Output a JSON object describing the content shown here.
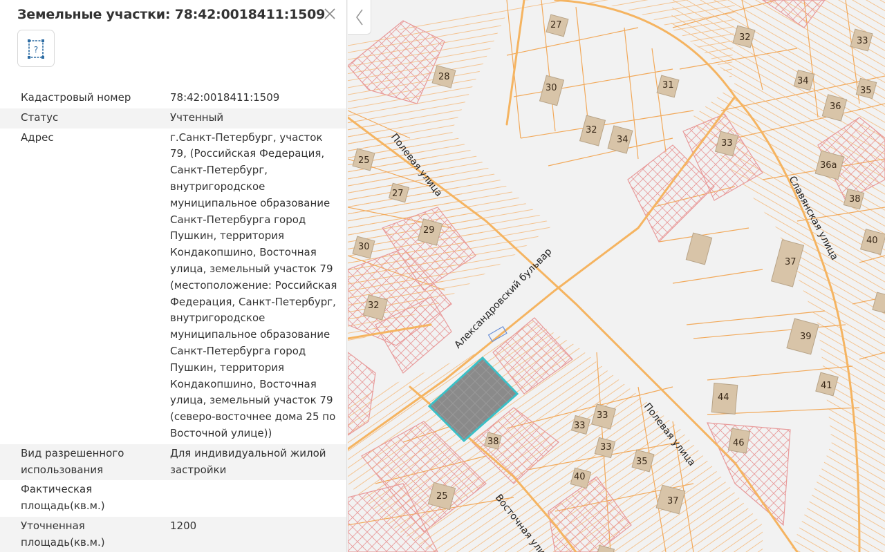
{
  "panel": {
    "title": "Земельные участки: 78:42:0018411:1509",
    "info_button_glyph": "?",
    "rows": [
      {
        "label": "Кадастровый номер",
        "value": "78:42:0018411:1509"
      },
      {
        "label": "Статус",
        "value": "Учтенный"
      },
      {
        "label": "Адрес",
        "value": "г.Санкт-Петербург, участок 79, (Российская Федерация, Санкт-Петербург, внутригородское муниципальное образование Санкт-Петербурга город Пушкин, территория Кондакопшино, Восточная улица, земельный участок 79 (местоположение: Российская Федерация, Санкт-Петербург, внутригородское муниципальное образование Санкт-Петербурга город Пушкин, территория Кондакопшино, Восточная улица, земельный участок 79 (северо-восточнее дома 25 по Восточной улице))"
      },
      {
        "label": "Вид разрешенного использования",
        "value": "Для индивидуальной жилой застройки"
      },
      {
        "label": "Фактическая площадь(кв.м.)",
        "value": ""
      },
      {
        "label": "Уточненная площадь(кв.м.)",
        "value": "1200"
      }
    ]
  },
  "map": {
    "streets": {
      "polevaya_top": "Полевая улица",
      "aleksandrovsky": "Александровский бульвар",
      "polevaya_bottom": "Полевая улица",
      "vostochnaya": "Восточная улица",
      "slavyanskaya": "Славянская улица"
    },
    "parcel_numbers": [
      "27",
      "32",
      "33",
      "28",
      "30",
      "31",
      "34",
      "35",
      "36",
      "32",
      "34",
      "33",
      "36а",
      "25",
      "27",
      "29",
      "38",
      "30",
      "37",
      "40",
      "32",
      "39",
      "41",
      "44",
      "33",
      "33",
      "38",
      "33",
      "35",
      "46",
      "40",
      "25",
      "37"
    ],
    "colors": {
      "road": "#f5b461",
      "parcel_line": "#f2a95a",
      "hatched": "#e89a9a",
      "building": "#d8c4a8",
      "selected_fill": "#8a8a8a",
      "selected_outline": "#39c0c7"
    }
  }
}
